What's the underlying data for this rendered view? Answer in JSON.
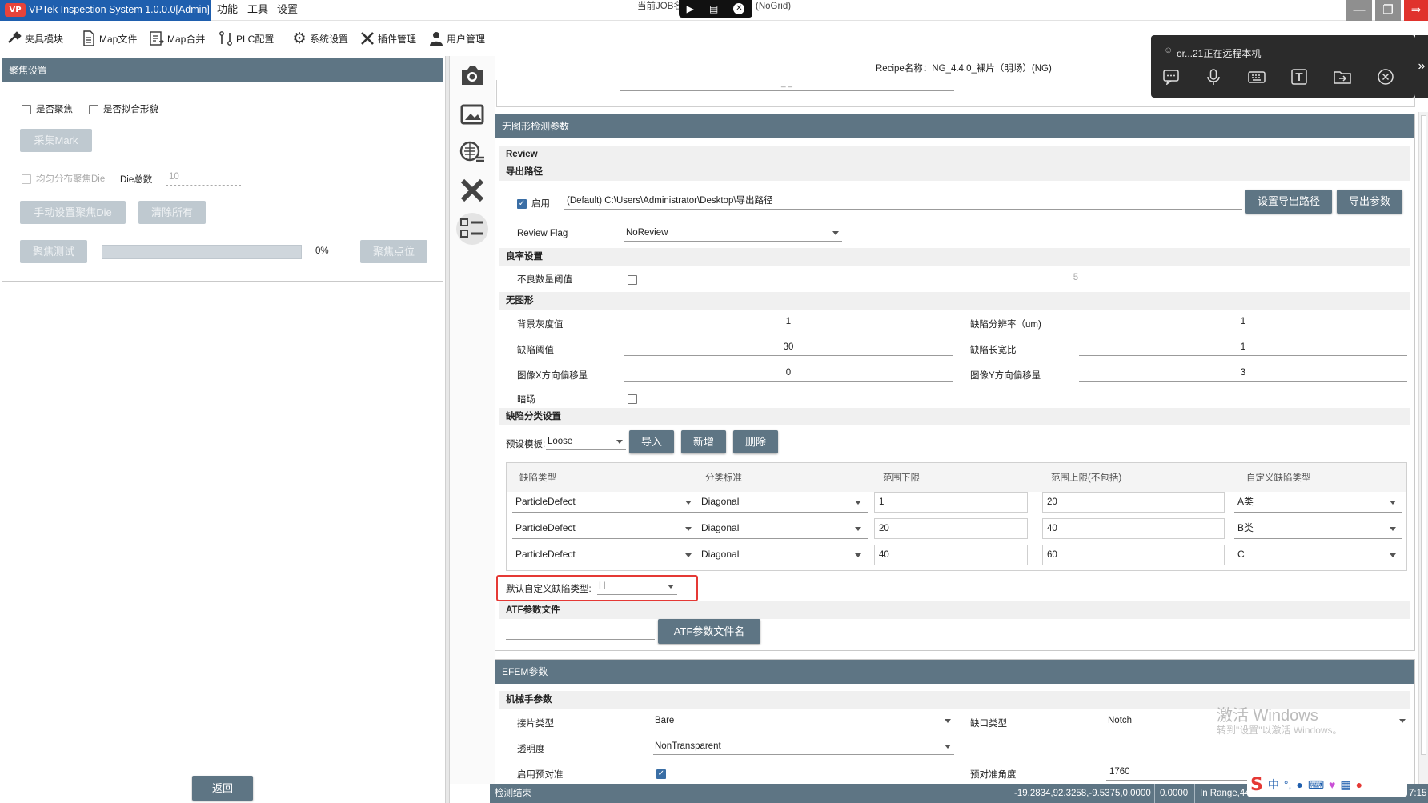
{
  "titlebar": {
    "app_title": "VPTek Inspection System 1.0.0.0[Admin]",
    "logo_text": "VP",
    "menus": [
      "功能",
      "工具",
      "设置"
    ],
    "job_label": "当前JOB名",
    "grid_label": "(NoGrid)"
  },
  "toolbar": {
    "items": [
      {
        "label": "夹具模块",
        "icon": "wrench-hammer-icon"
      },
      {
        "label": "Map文件",
        "icon": "file-icon"
      },
      {
        "label": "Map合并",
        "icon": "merge-file-icon"
      },
      {
        "label": "PLC配置",
        "icon": "plc-icon"
      },
      {
        "label": "系统设置",
        "icon": "gear-icon"
      },
      {
        "label": "插件管理",
        "icon": "tools-icon"
      },
      {
        "label": "用户管理",
        "icon": "user-icon"
      }
    ]
  },
  "left_panel": {
    "title": "聚焦设置",
    "chk_focus": "是否聚焦",
    "chk_fit": "是否拟合形貌",
    "btn_collect_mark": "采集Mark",
    "chk_uniform": "均匀分布聚焦Die",
    "die_total_label": "Die总数",
    "die_total_value": "10",
    "btn_manual_die": "手动设置聚焦Die",
    "btn_clear_all": "清除所有",
    "btn_focus_test": "聚焦测试",
    "progress_fraction": 0,
    "progress_text": "0%",
    "btn_focus_point": "聚焦点位",
    "btn_back": "返回"
  },
  "vertical_tools": [
    "camera-icon",
    "image-edit-icon",
    "wafer-list-icon",
    "tools-icon",
    "checklist-icon"
  ],
  "recipe": {
    "label": "Recipe名称：NG_4.4.0_裸片（明场）(NG)",
    "top_field": "_ _"
  },
  "remote_popup": {
    "title": "or...21正在远程本机",
    "icons": [
      "chat-icon",
      "mic-icon",
      "keyboard-icon",
      "text-icon",
      "folder-icon",
      "close-circle-icon"
    ]
  },
  "main": {
    "section_title": "无图形检测参数",
    "review_title": "Review",
    "export_path_title": "导出路径",
    "enable_label": "启用",
    "enable_checked": true,
    "export_path_value": "(Default) C:\\Users\\Administrator\\Desktop\\导出路径",
    "btn_set_path": "设置导出路径",
    "btn_export_params": "导出参数",
    "review_flag_label": "Review Flag",
    "review_flag_value": "NoReview",
    "yield_title": "良率设置",
    "bad_count_label": "不良数量阈值",
    "bad_count_checked": false,
    "bad_count_value": "5",
    "nopattern_title": "无图形",
    "bg_gray_label": "背景灰度值",
    "bg_gray_value": "1",
    "defect_res_label": "缺陷分辨率（um)",
    "defect_res_value": "1",
    "defect_thresh_label": "缺陷阈值",
    "defect_thresh_value": "30",
    "defect_aspect_label": "缺陷长宽比",
    "defect_aspect_value": "1",
    "img_x_label": "图像X方向偏移量",
    "img_x_value": "0",
    "img_y_label": "图像Y方向偏移量",
    "img_y_value": "3",
    "darkfield_label": "暗场",
    "darkfield_checked": false,
    "classify_title": "缺陷分类设置",
    "preset_label": "预设模板:",
    "preset_value": "Loose",
    "btn_import": "导入",
    "btn_add": "新增",
    "btn_delete": "删除",
    "table_headers": [
      "缺陷类型",
      "分类标准",
      "范围下限",
      "范围上限(不包括)",
      "自定义缺陷类型"
    ],
    "table_rows": [
      [
        "ParticleDefect",
        "Diagonal",
        "1",
        "20",
        "A类"
      ],
      [
        "ParticleDefect",
        "Diagonal",
        "20",
        "40",
        "B类"
      ],
      [
        "ParticleDefect",
        "Diagonal",
        "40",
        "60",
        "C"
      ]
    ],
    "default_type_label": "默认自定义缺陷类型:",
    "default_type_value": "H",
    "highlight_color": "#e53935",
    "atf_title": "ATF参数文件",
    "btn_atf": "ATF参数文件名"
  },
  "efem": {
    "section_title": "EFEM参数",
    "robot_title": "机械手参数",
    "wafer_type_label": "接片类型",
    "wafer_type_value": "Bare",
    "notch_label": "缺口类型",
    "notch_value": "Notch",
    "transparency_label": "透明度",
    "transparency_value": "NonTransparent",
    "prealign_label": "启用预对准",
    "prealign_checked": true,
    "prealign_angle_label": "预对准角度",
    "prealign_angle_value": "1760"
  },
  "watermark": {
    "line1": "激活 Windows",
    "line2": "转到\"设置\"以激活 Windows。"
  },
  "statusbar": {
    "left": "检测结束",
    "coords": "-19.2834,92.3258,-9.5375,0.0000",
    "value2": "0.0000",
    "range": "In Range,449",
    "clock": "7:15"
  },
  "colors": {
    "header": "#5e7584",
    "titlebar_blue": "#1f5fae",
    "button": "#5e7584",
    "button_disabled": "#bfc9d0"
  }
}
